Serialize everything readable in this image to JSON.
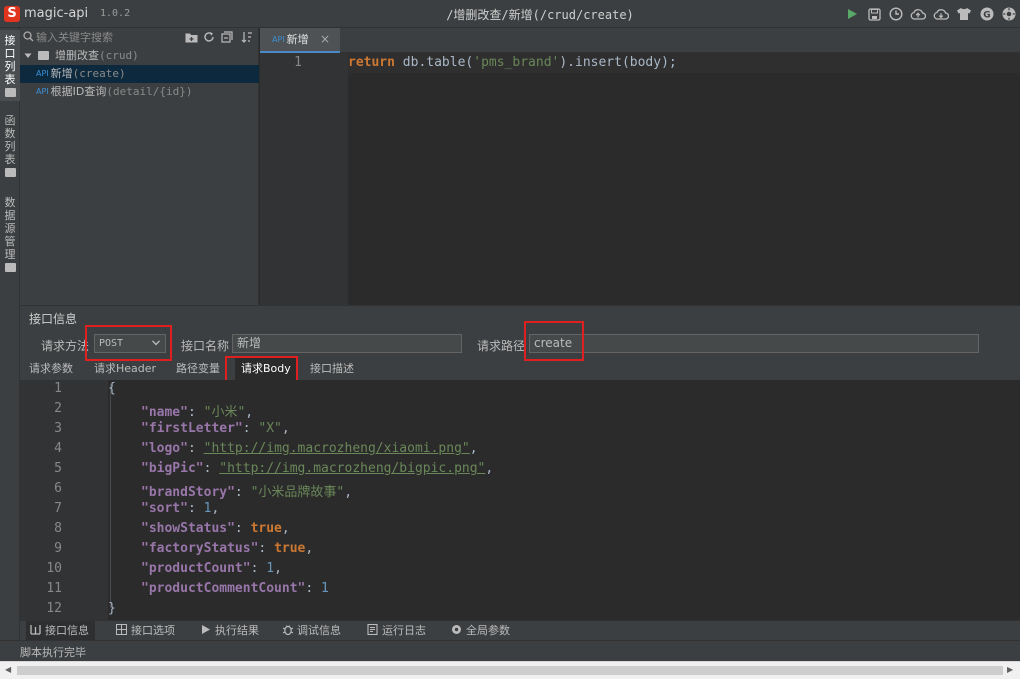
{
  "app": {
    "logo_letter": "S",
    "name": "magic-api",
    "version": "1.0.2",
    "path_title": "/增删改查/新增(/crud/create)",
    "toolbar_icons": [
      "run-icon",
      "save-icon",
      "history-icon",
      "upload-icon",
      "download-icon",
      "skin-icon",
      "github-icon",
      "settings-icon"
    ],
    "accent": "#4a88c7",
    "run_color": "#59a869"
  },
  "sidebar": {
    "tabs": [
      {
        "label": "接口列表",
        "chars": [
          "接",
          "口",
          "列",
          "表"
        ]
      },
      {
        "label": "函数列表",
        "chars": [
          "函",
          "数",
          "列",
          "表"
        ]
      },
      {
        "label": "数据源管理",
        "chars": [
          "数",
          "据",
          "源",
          "管",
          "理"
        ]
      }
    ]
  },
  "tree": {
    "search_placeholder": "输入关键字搜索",
    "tools": [
      "new-group-icon",
      "refresh-icon",
      "collapse-icon",
      "sort-icon"
    ],
    "group": {
      "name": "增删改查",
      "path": "(crud)"
    },
    "items": [
      {
        "tag": "API",
        "name": "新增",
        "path": "(create)"
      },
      {
        "tag": "API",
        "name": "根据ID查询",
        "path": "(detail/{id})"
      }
    ]
  },
  "editor": {
    "tab": {
      "tag": "API",
      "label": "新增",
      "close": "×"
    },
    "line_no": "1",
    "code": {
      "kw": "return",
      "pre": " db.table(",
      "str": "'pms_brand'",
      "post": ").insert(body);"
    }
  },
  "info": {
    "title": "接口信息",
    "method_label": "请求方法",
    "method_value": "POST",
    "name_label": "接口名称",
    "name_value": "新增",
    "path_label": "请求路径",
    "path_value": "create",
    "sub_tabs": [
      "请求参数",
      "请求Header",
      "路径变量",
      "请求Body",
      "接口描述"
    ],
    "active_sub_tab": 3
  },
  "body": {
    "line_numbers": [
      "1",
      "2",
      "3",
      "4",
      "5",
      "6",
      "7",
      "8",
      "9",
      "10",
      "11",
      "12"
    ],
    "open": "{",
    "close": "}",
    "fields": [
      {
        "key": "\"name\"",
        "value": "\"小米\"",
        "type": "str",
        "comma": ","
      },
      {
        "key": "\"firstLetter\"",
        "value": "\"X\"",
        "type": "str",
        "comma": ","
      },
      {
        "key": "\"logo\"",
        "value": "\"http://img.macrozheng/xiaomi.png\"",
        "type": "link",
        "comma": ","
      },
      {
        "key": "\"bigPic\"",
        "value": "\"http://img.macrozheng/bigpic.png\"",
        "type": "link",
        "comma": ","
      },
      {
        "key": "\"brandStory\"",
        "value": "\"小米品牌故事\"",
        "type": "str",
        "comma": ","
      },
      {
        "key": "\"sort\"",
        "value": "1",
        "type": "num",
        "comma": ","
      },
      {
        "key": "\"showStatus\"",
        "value": "true",
        "type": "bool",
        "comma": ","
      },
      {
        "key": "\"factoryStatus\"",
        "value": "true",
        "type": "bool",
        "comma": ","
      },
      {
        "key": "\"productCount\"",
        "value": "1",
        "type": "num",
        "comma": ","
      },
      {
        "key": "\"productCommentCount\"",
        "value": "1",
        "type": "num",
        "comma": ""
      }
    ]
  },
  "bottom_tabs": [
    {
      "label": "接口信息",
      "icon": "columns-icon"
    },
    {
      "label": "接口选项",
      "icon": "grid-icon"
    },
    {
      "label": "执行结果",
      "icon": "play-icon"
    },
    {
      "label": "调试信息",
      "icon": "bug-icon"
    },
    {
      "label": "运行日志",
      "icon": "log-icon"
    },
    {
      "label": "全局参数",
      "icon": "gear-icon"
    }
  ],
  "status": {
    "text": "脚本执行完毕"
  }
}
